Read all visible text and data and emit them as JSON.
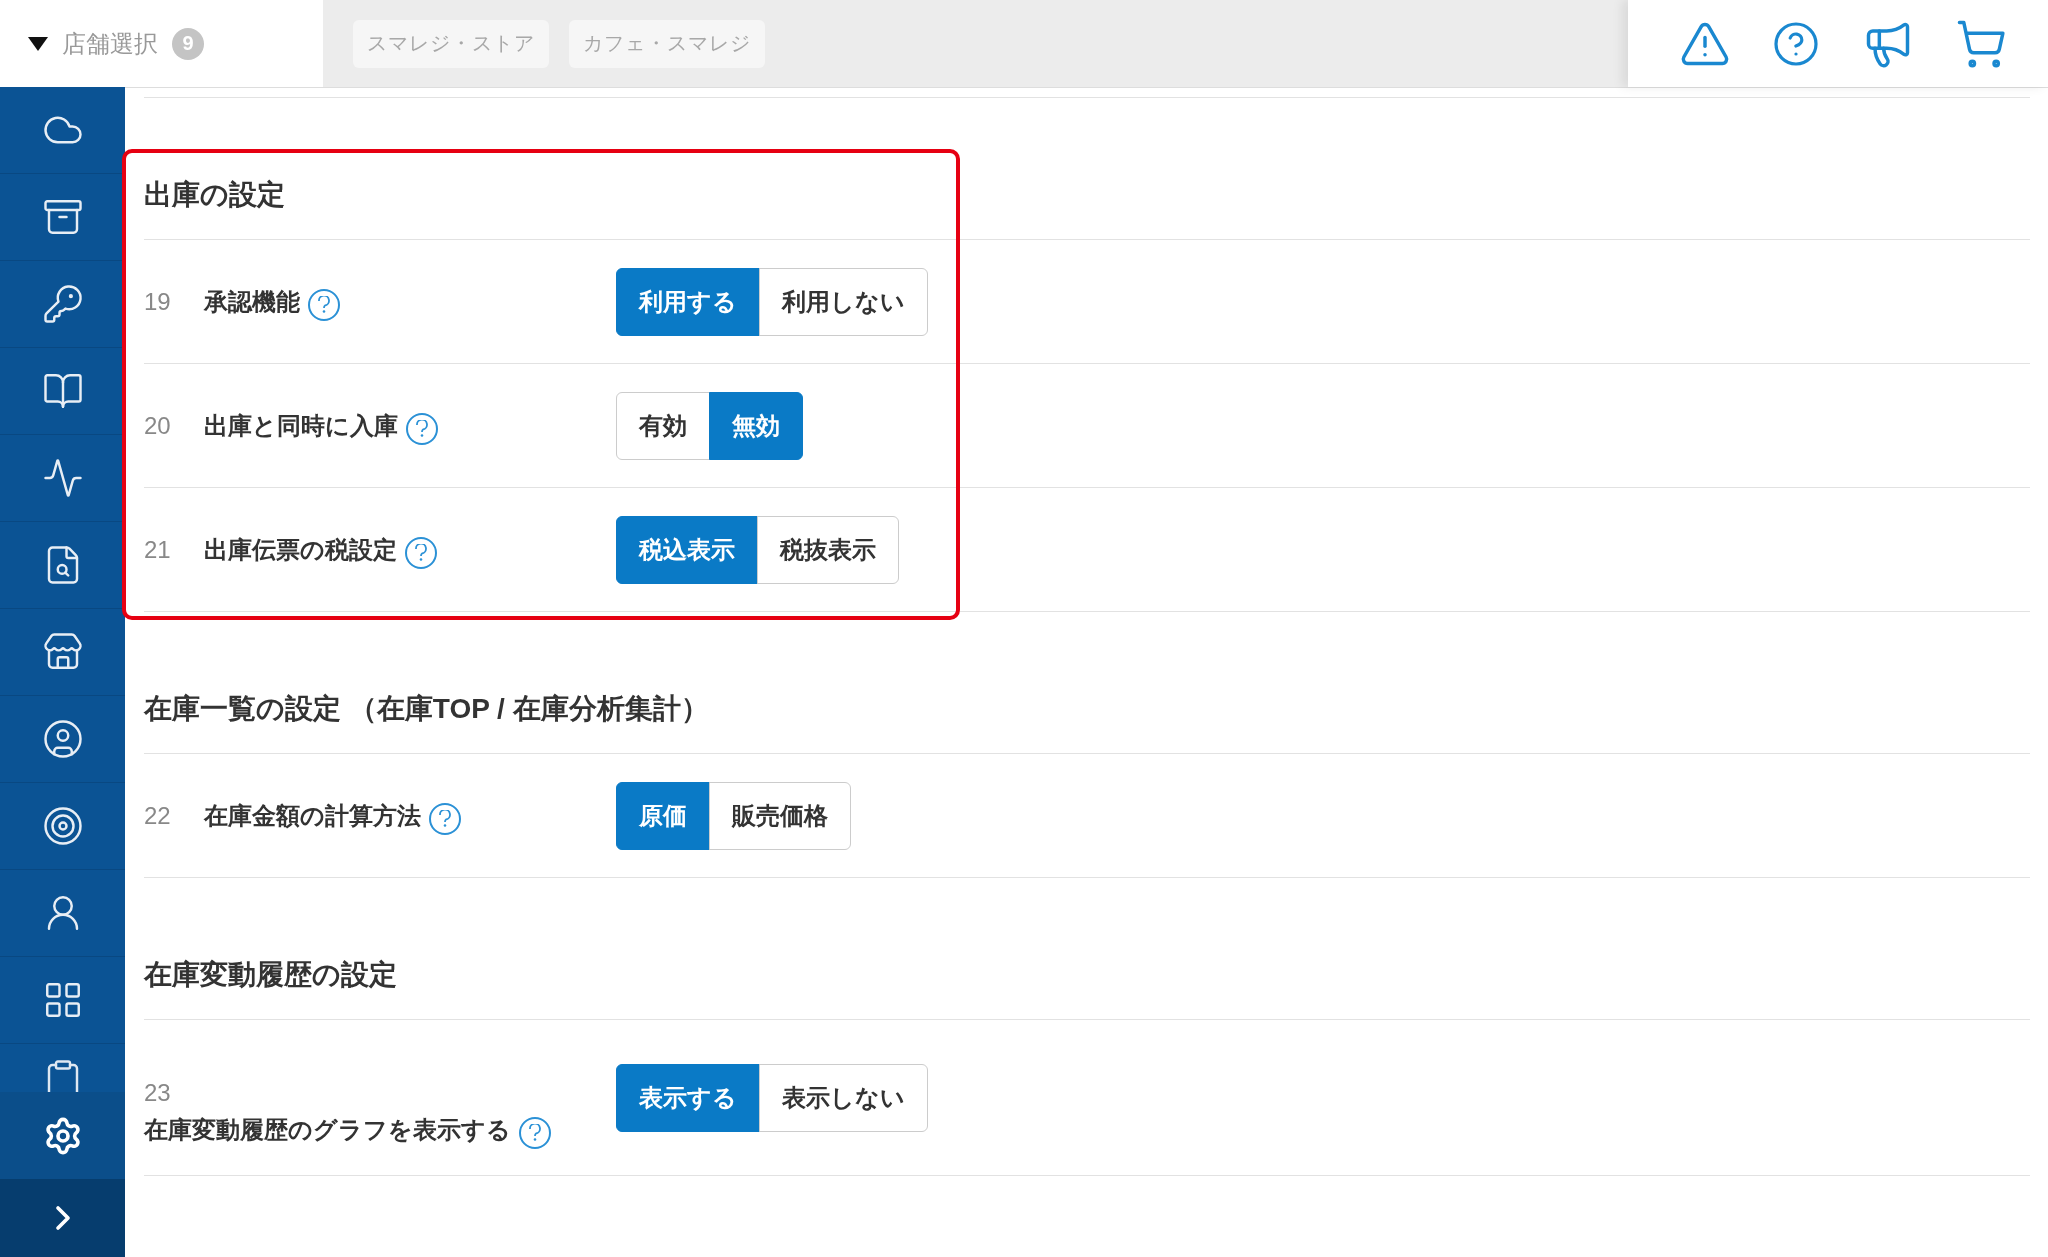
{
  "store_selector": {
    "label": "店舗選択",
    "count": "9"
  },
  "store_tabs": [
    {
      "label": "スマレジ・ストア"
    },
    {
      "label": "カフェ・スマレジ"
    }
  ],
  "sections": [
    {
      "title": "出庫の設定",
      "highlighted": true,
      "rows": [
        {
          "number": "19",
          "label": "承認機能",
          "kind": "inline",
          "options": [
            {
              "label": "利用する",
              "selected": true
            },
            {
              "label": "利用しない",
              "selected": false
            }
          ]
        },
        {
          "number": "20",
          "label": "出庫と同時に入庫",
          "kind": "inline",
          "options": [
            {
              "label": "有効",
              "selected": false
            },
            {
              "label": "無効",
              "selected": true
            }
          ]
        },
        {
          "number": "21",
          "label": "出庫伝票の税設定",
          "kind": "inline",
          "options": [
            {
              "label": "税込表示",
              "selected": true
            },
            {
              "label": "税抜表示",
              "selected": false
            }
          ]
        }
      ]
    },
    {
      "title": "在庫一覧の設定 （在庫TOP / 在庫分析集計）",
      "highlighted": false,
      "rows": [
        {
          "number": "22",
          "label": "在庫金額の計算方法",
          "kind": "inline",
          "options": [
            {
              "label": "原価",
              "selected": true
            },
            {
              "label": "販売価格",
              "selected": false
            }
          ]
        }
      ]
    },
    {
      "title": "在庫変動履歴の設定",
      "highlighted": false,
      "rows": [
        {
          "number": "23",
          "label": "在庫変動履歴のグラフを表示する",
          "kind": "stacked",
          "options": [
            {
              "label": "表示する",
              "selected": true
            },
            {
              "label": "表示しない",
              "selected": false
            }
          ]
        }
      ]
    }
  ]
}
